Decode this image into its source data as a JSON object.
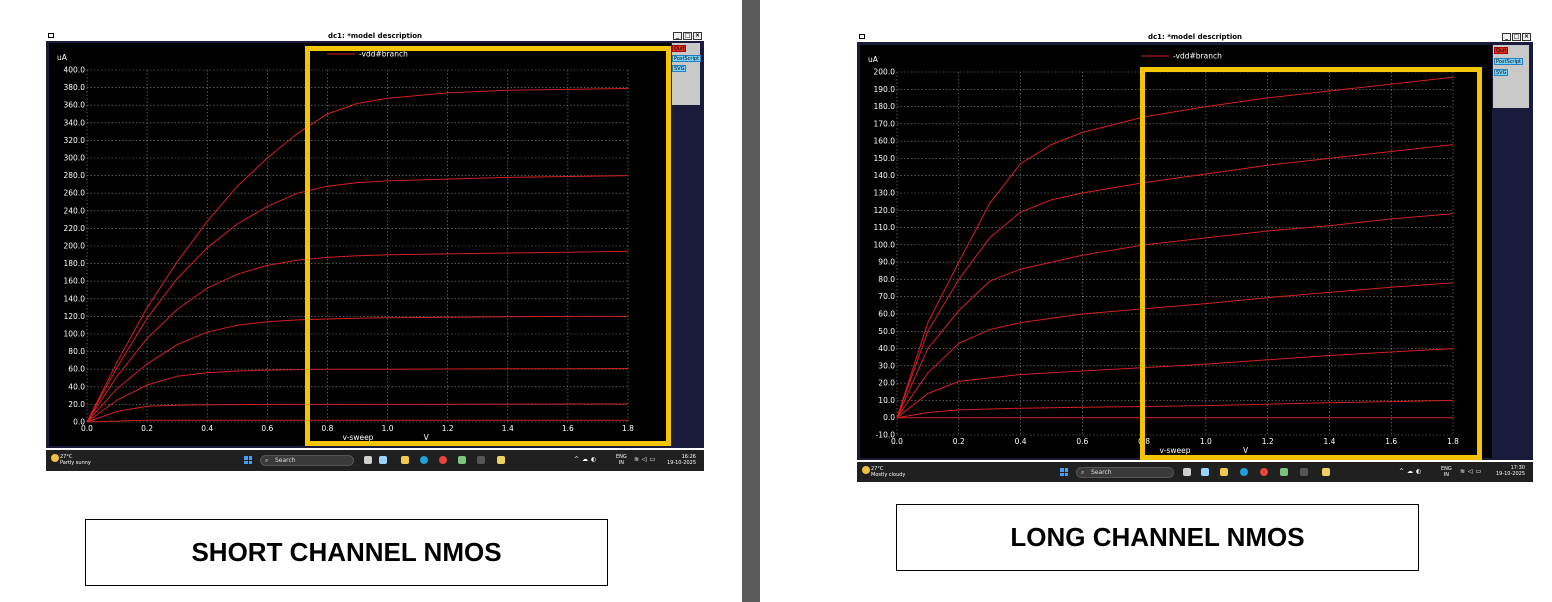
{
  "panels": [
    {
      "id": "short",
      "window_title": "dc1: *model description",
      "caption": "SHORT CHANNEL NMOS",
      "legend": "-vdd#branch",
      "side_buttons": [
        "Quit",
        "PostScript",
        "SVG"
      ],
      "taskbar": {
        "temp": "27°C",
        "weather": "Partly sunny",
        "search": "Search",
        "lang": "ENG",
        "region": "IN",
        "time": "16:26",
        "date": "19-10-2025"
      }
    },
    {
      "id": "long",
      "window_title": "dc1: *model description",
      "caption": "LONG CHANNEL NMOS",
      "legend": "-vdd#branch",
      "side_buttons": [
        "Quit",
        "PostScript",
        "SVG"
      ],
      "taskbar": {
        "temp": "27°C",
        "weather": "Mostly cloudy",
        "search": "Search",
        "lang": "ENG",
        "region": "IN",
        "time": "17:30",
        "date": "19-10-2025"
      }
    }
  ],
  "colors": {
    "trace": "#d42020",
    "highlight": "#f5c400",
    "plot_bg": "#000000",
    "grid": "#8a8a8a"
  },
  "chart_data": [
    {
      "type": "line",
      "ylabel": "uA",
      "xlabel": "V",
      "xname": "v-sweep",
      "xlim": [
        0,
        1.8
      ],
      "ylim": [
        0,
        400
      ],
      "xticks": [
        0.0,
        0.2,
        0.4,
        0.6,
        0.8,
        1.0,
        1.2,
        1.4,
        1.6,
        1.8
      ],
      "yticks": [
        0,
        20,
        40,
        60,
        80,
        100,
        120,
        140,
        160,
        180,
        200,
        220,
        240,
        260,
        280,
        300,
        320,
        340,
        360,
        380,
        400
      ],
      "ytick_labels": [
        "0.0",
        "20.0",
        "40.0",
        "60.0",
        "80.0",
        "100.0",
        "120.0",
        "140.0",
        "160.0",
        "180.0",
        "200.0",
        "220.0",
        "240.0",
        "260.0",
        "280.0",
        "300.0",
        "320.0",
        "340.0",
        "360.0",
        "380.0",
        "400.0"
      ],
      "xtick_labels": [
        "0.0",
        "0.2",
        "0.4",
        "0.6",
        "0.8",
        "1.0",
        "1.2",
        "1.4",
        "1.6",
        "1.8"
      ],
      "grid": true,
      "series": [
        {
          "x": [
            0,
            0.1,
            0.2,
            0.3,
            0.4,
            0.5,
            0.6,
            0.7,
            0.8,
            0.9,
            1.0,
            1.2,
            1.4,
            1.6,
            1.8
          ],
          "values": [
            0,
            1,
            2,
            2,
            2,
            2,
            2,
            2,
            2,
            2,
            2,
            2,
            2,
            2,
            2
          ]
        },
        {
          "x": [
            0,
            0.1,
            0.2,
            0.3,
            0.4,
            0.5,
            0.6,
            0.7,
            0.8,
            0.9,
            1.0,
            1.2,
            1.4,
            1.6,
            1.8
          ],
          "values": [
            0,
            12,
            18,
            19,
            19.5,
            19.8,
            20,
            20,
            20,
            20,
            20,
            20.2,
            20.3,
            20.4,
            20.5
          ]
        },
        {
          "x": [
            0,
            0.1,
            0.2,
            0.3,
            0.4,
            0.5,
            0.6,
            0.7,
            0.8,
            0.9,
            1.0,
            1.2,
            1.4,
            1.6,
            1.8
          ],
          "values": [
            0,
            25,
            42,
            52,
            56,
            58,
            59,
            59.5,
            60,
            60,
            60,
            60.2,
            60.4,
            60.6,
            60.8
          ]
        },
        {
          "x": [
            0,
            0.1,
            0.2,
            0.3,
            0.4,
            0.5,
            0.6,
            0.7,
            0.8,
            0.9,
            1.0,
            1.2,
            1.4,
            1.6,
            1.8
          ],
          "values": [
            0,
            38,
            66,
            88,
            102,
            110,
            114,
            116,
            117,
            118,
            118.5,
            119,
            119.5,
            120,
            120
          ]
        },
        {
          "x": [
            0,
            0.1,
            0.2,
            0.3,
            0.4,
            0.5,
            0.6,
            0.7,
            0.8,
            0.9,
            1.0,
            1.2,
            1.4,
            1.6,
            1.8
          ],
          "values": [
            0,
            52,
            95,
            128,
            152,
            168,
            178,
            184,
            187,
            189,
            190,
            191,
            192,
            193,
            194
          ]
        },
        {
          "x": [
            0,
            0.1,
            0.2,
            0.3,
            0.4,
            0.5,
            0.6,
            0.7,
            0.8,
            0.9,
            1.0,
            1.2,
            1.4,
            1.6,
            1.8
          ],
          "values": [
            0,
            62,
            118,
            163,
            198,
            225,
            245,
            260,
            268,
            272,
            274,
            276,
            278,
            279,
            280
          ]
        },
        {
          "x": [
            0,
            0.1,
            0.2,
            0.3,
            0.4,
            0.5,
            0.6,
            0.7,
            0.8,
            0.9,
            1.0,
            1.2,
            1.4,
            1.6,
            1.8
          ],
          "values": [
            0,
            68,
            130,
            182,
            228,
            268,
            300,
            328,
            350,
            362,
            368,
            374,
            377,
            378,
            379
          ]
        }
      ]
    },
    {
      "type": "line",
      "ylabel": "uA",
      "xlabel": "V",
      "xname": "v-sweep",
      "xlim": [
        0,
        1.8
      ],
      "ylim": [
        -10,
        200
      ],
      "xticks": [
        0.0,
        0.2,
        0.4,
        0.6,
        0.8,
        1.0,
        1.2,
        1.4,
        1.6,
        1.8
      ],
      "yticks": [
        -10,
        0,
        10,
        20,
        30,
        40,
        50,
        60,
        70,
        80,
        90,
        100,
        110,
        120,
        130,
        140,
        150,
        160,
        170,
        180,
        190,
        200
      ],
      "ytick_labels": [
        "-10.0",
        "0.0",
        "10.0",
        "20.0",
        "30.0",
        "40.0",
        "50.0",
        "60.0",
        "70.0",
        "80.0",
        "90.0",
        "100.0",
        "110.0",
        "120.0",
        "130.0",
        "140.0",
        "150.0",
        "160.0",
        "170.0",
        "180.0",
        "190.0",
        "200.0"
      ],
      "xtick_labels": [
        "0.0",
        "0.2",
        "0.4",
        "0.6",
        "0.8",
        "1.0",
        "1.2",
        "1.4",
        "1.6",
        "1.8"
      ],
      "grid": true,
      "series": [
        {
          "x": [
            0,
            0.1,
            0.2,
            0.4,
            0.6,
            0.8,
            1.0,
            1.2,
            1.4,
            1.6,
            1.8
          ],
          "values": [
            0,
            0,
            0,
            0,
            0,
            0,
            0,
            0,
            0,
            0,
            0
          ]
        },
        {
          "x": [
            0,
            0.1,
            0.2,
            0.4,
            0.6,
            0.8,
            1.0,
            1.2,
            1.4,
            1.6,
            1.8
          ],
          "values": [
            0,
            3,
            4.5,
            5.5,
            6,
            6.5,
            7,
            7.8,
            8.6,
            9.3,
            10
          ]
        },
        {
          "x": [
            0,
            0.1,
            0.2,
            0.4,
            0.6,
            0.8,
            1.0,
            1.2,
            1.4,
            1.6,
            1.8
          ],
          "values": [
            0,
            14,
            21,
            25,
            27,
            29,
            31,
            33.5,
            36,
            38,
            40
          ]
        },
        {
          "x": [
            0,
            0.1,
            0.2,
            0.3,
            0.4,
            0.6,
            0.8,
            1.0,
            1.2,
            1.4,
            1.6,
            1.8
          ],
          "values": [
            0,
            26,
            43,
            51,
            55,
            60,
            63,
            66,
            69.5,
            72.5,
            75.5,
            78
          ]
        },
        {
          "x": [
            0,
            0.1,
            0.2,
            0.3,
            0.4,
            0.6,
            0.8,
            1.0,
            1.2,
            1.4,
            1.6,
            1.8
          ],
          "values": [
            0,
            40,
            62,
            79,
            86,
            94,
            100,
            104,
            108,
            111,
            115,
            118
          ]
        },
        {
          "x": [
            0,
            0.1,
            0.2,
            0.3,
            0.4,
            0.5,
            0.6,
            0.8,
            1.0,
            1.2,
            1.4,
            1.6,
            1.8
          ],
          "values": [
            0,
            50,
            80,
            104,
            119,
            126,
            130,
            136,
            141,
            146,
            150,
            154,
            158
          ]
        },
        {
          "x": [
            0,
            0.1,
            0.2,
            0.3,
            0.4,
            0.5,
            0.6,
            0.8,
            1.0,
            1.2,
            1.4,
            1.6,
            1.8
          ],
          "values": [
            0,
            55,
            90,
            124,
            147,
            158,
            165,
            174,
            180,
            185,
            189,
            193,
            197
          ]
        }
      ]
    }
  ]
}
